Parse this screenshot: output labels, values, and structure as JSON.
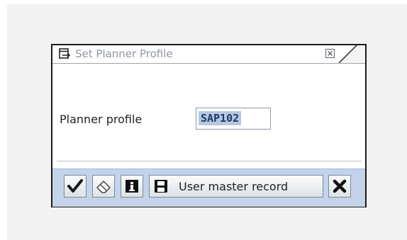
{
  "dialog": {
    "title": "Set Planner Profile",
    "title_icon": "dialog-window-icon",
    "close_icon": "close-x-icon"
  },
  "form": {
    "planner_profile_label": "Planner profile",
    "planner_profile_value": "SAP102"
  },
  "toolbar": {
    "buttons": [
      {
        "icon": "checkmark-icon",
        "label": ""
      },
      {
        "icon": "eraser-icon",
        "label": ""
      },
      {
        "icon": "info-icon",
        "label": ""
      },
      {
        "icon": "save-icon",
        "label": "User master record"
      },
      {
        "icon": "cancel-x-icon",
        "label": ""
      }
    ]
  },
  "colors": {
    "toolbar_bg": "#c3d3e9",
    "selection_bg": "#b6c8e0",
    "title_text": "#9096a0"
  }
}
